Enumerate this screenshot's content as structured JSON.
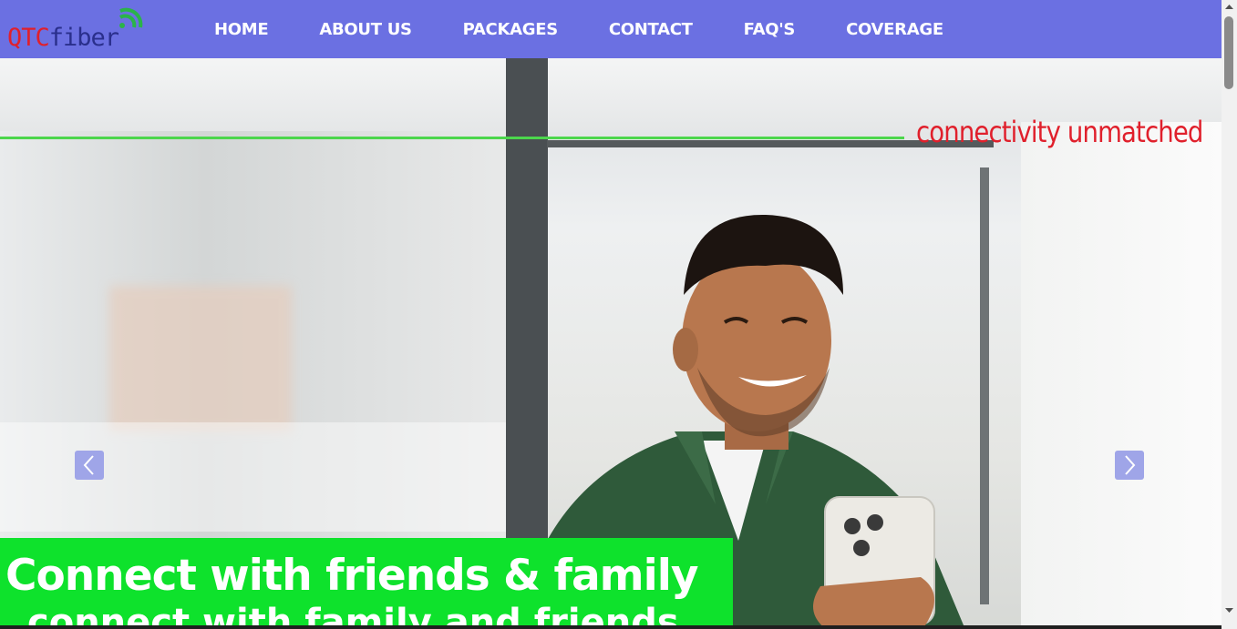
{
  "brand": {
    "logo_part1": "QTC",
    "logo_part2": "fiber"
  },
  "nav": {
    "items": [
      {
        "label": "HOME"
      },
      {
        "label": "ABOUT US"
      },
      {
        "label": "PACKAGES"
      },
      {
        "label": "CONTACT"
      },
      {
        "label": "FAQ'S"
      },
      {
        "label": "COVERAGE"
      }
    ]
  },
  "hero": {
    "tagline": "connectivity unmatched",
    "caption_title": "Connect with friends & family",
    "caption_subtitle": "connect with family and friends"
  },
  "colors": {
    "nav_bg": "#6b70e2",
    "accent_red": "#e0202c",
    "accent_green": "#0ee22c",
    "logo_blue": "#2a2f8c"
  },
  "icons": {
    "prev": "chevron-left-icon",
    "next": "chevron-right-icon",
    "logo": "wifi-signal-icon"
  }
}
